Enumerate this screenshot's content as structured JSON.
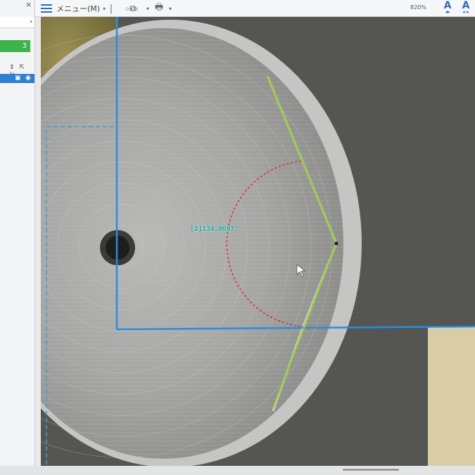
{
  "toolbar": {
    "menu_label": "メニュー(M)",
    "ocr_label": "OWTX",
    "zoom_level": "820%"
  },
  "left_panel": {
    "count_badge": "3"
  },
  "measurement": {
    "angle_label": "[1]134.9697°"
  },
  "colors": {
    "accent": "#2e6fb8",
    "badge_green": "#3cb44b",
    "measure_line": "#9ccd3c",
    "arc": "#e0303a",
    "roi": "#2a8be0",
    "label": "#1aa9a0"
  }
}
